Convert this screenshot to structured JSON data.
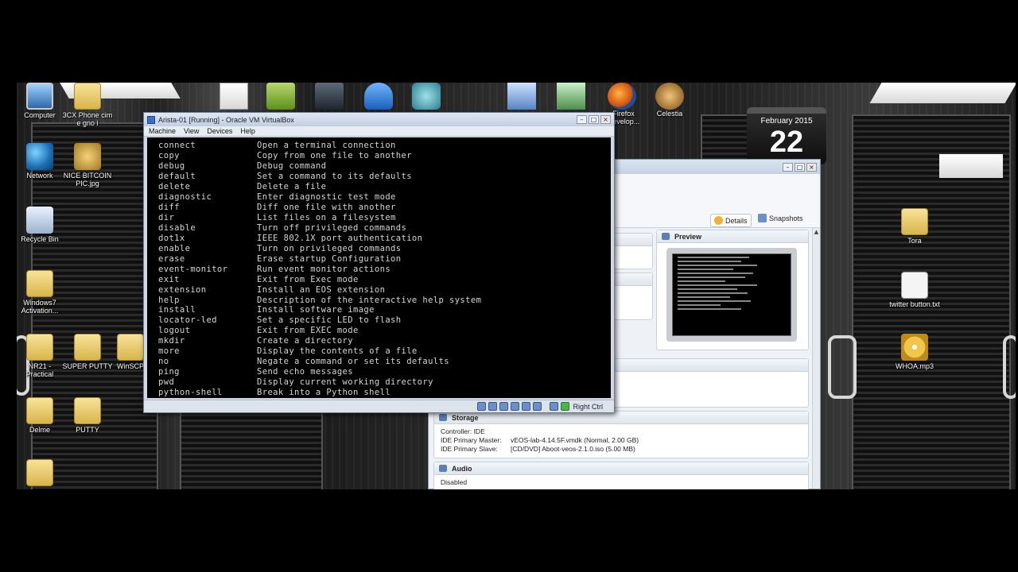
{
  "desktop_icons": [
    {
      "label": "Computer",
      "glyph": "monitor-icon"
    },
    {
      "label": "3CX Phone cim e gno i",
      "glyph": "folder-icon"
    },
    {
      "label": "Network",
      "glyph": "network-icon"
    },
    {
      "label": "NICE BITCOIN PIC.jpg",
      "glyph": "coin-icon"
    },
    {
      "label": "Recycle Bin",
      "glyph": "recycle-bin-icon"
    },
    {
      "label": "Windows7 Activation...",
      "glyph": "folder-icon"
    },
    {
      "label": "NR21 - Practical",
      "glyph": "folder-icon"
    },
    {
      "label": "SUPER PUTTY",
      "glyph": "folder-icon"
    },
    {
      "label": "WinSCP",
      "glyph": "folder-icon"
    },
    {
      "label": "Delme",
      "glyph": "folder-icon"
    },
    {
      "label": "PUTTY",
      "glyph": "folder-icon"
    },
    {
      "label": "Tora",
      "glyph": "folder-icon"
    },
    {
      "label": "twitter button.txt",
      "glyph": "text-file-icon"
    },
    {
      "label": "WHOA.mp3",
      "glyph": "cd-icon"
    },
    {
      "label": "Celestia",
      "glyph": "planet-icon"
    },
    {
      "label": "Firefox Develop...",
      "glyph": "firefox-icon"
    }
  ],
  "calendar": {
    "month": "February 2015",
    "day": "22"
  },
  "vm_window": {
    "title": "Arista-01 [Running] - Oracle VM VirtualBox",
    "menu": [
      "Machine",
      "View",
      "Devices",
      "Help"
    ],
    "terminal_lines": [
      {
        "cmd": "connect",
        "desc": "Open a terminal connection"
      },
      {
        "cmd": "copy",
        "desc": "Copy from one file to another"
      },
      {
        "cmd": "debug",
        "desc": "Debug command"
      },
      {
        "cmd": "default",
        "desc": "Set a command to its defaults"
      },
      {
        "cmd": "delete",
        "desc": "Delete a file"
      },
      {
        "cmd": "diagnostic",
        "desc": "Enter diagnostic test mode"
      },
      {
        "cmd": "diff",
        "desc": "Diff one file with another"
      },
      {
        "cmd": "dir",
        "desc": "List files on a filesystem"
      },
      {
        "cmd": "disable",
        "desc": "Turn off privileged commands"
      },
      {
        "cmd": "dot1x",
        "desc": "IEEE 802.1X port authentication"
      },
      {
        "cmd": "enable",
        "desc": "Turn on privileged commands"
      },
      {
        "cmd": "erase",
        "desc": "Erase startup Configuration"
      },
      {
        "cmd": "event-monitor",
        "desc": "Run event monitor actions"
      },
      {
        "cmd": "exit",
        "desc": "Exit from Exec mode"
      },
      {
        "cmd": "extension",
        "desc": "Install an EOS extension"
      },
      {
        "cmd": "help",
        "desc": "Description of the interactive help system"
      },
      {
        "cmd": "install",
        "desc": "Install software image"
      },
      {
        "cmd": "locator-led",
        "desc": "Set a specific LED to flash"
      },
      {
        "cmd": "logout",
        "desc": "Exit from EXEC mode"
      },
      {
        "cmd": "mkdir",
        "desc": "Create a directory"
      },
      {
        "cmd": "more",
        "desc": "Display the contents of a file"
      },
      {
        "cmd": "no",
        "desc": "Negate a command or set its defaults"
      },
      {
        "cmd": "ping",
        "desc": "Send echo messages"
      },
      {
        "cmd": "pwd",
        "desc": "Display current working directory"
      },
      {
        "cmd": "python-shell",
        "desc": "Break into a Python shell"
      }
    ],
    "host_key": "Right Ctrl"
  },
  "manager": {
    "details_label": "Details",
    "snapshots_label": "Snapshots",
    "preview_title": "Preview",
    "storage": {
      "title": "Storage",
      "controller": "Controller: IDE",
      "rows": [
        {
          "k": "IDE Primary Master:",
          "v": "vEOS-lab-4.14.5F.vmdk (Normal, 2.00 GB)"
        },
        {
          "k": "IDE Primary Slave:",
          "v": "[CD/DVD] Aboot-veos-2.1.0.iso (5.00 MB)"
        }
      ]
    },
    "audio": {
      "title": "Audio",
      "value": "Disabled"
    }
  }
}
